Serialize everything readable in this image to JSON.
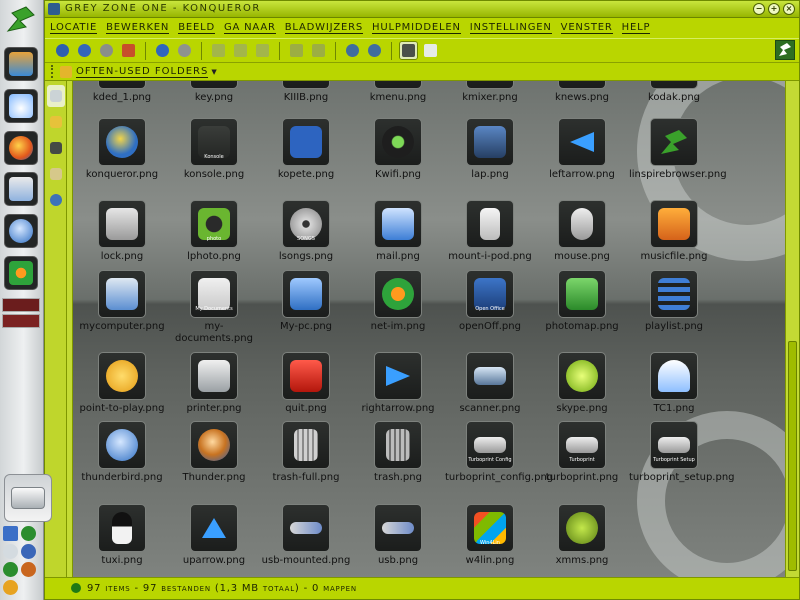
{
  "window": {
    "title": "GREY ZONE ONE - Konqueror"
  },
  "menubar": {
    "items": [
      "Locatie",
      "Bewerken",
      "Beeld",
      "Ga naar",
      "Bladwijzers",
      "Hulpmiddelen",
      "Instellingen",
      "Venster",
      "Help"
    ]
  },
  "bookmarks_toolbar": {
    "folder_label": "Often-used Folders"
  },
  "files": {
    "row0": [
      "kded_1.png",
      "key.png",
      "KIIIB.png",
      "kmenu.png",
      "kmixer.png",
      "knews.png",
      "kodak.png"
    ],
    "row1": [
      "konqueror.png",
      "konsole.png",
      "kopete.png",
      "Kwifi.png",
      "lap.png",
      "leftarrow.png",
      "linspirebrowser.png"
    ],
    "row2": [
      "lock.png",
      "lphoto.png",
      "lsongs.png",
      "mail.png",
      "mount-i-pod.png",
      "mouse.png",
      "musicfile.png"
    ],
    "row3": [
      "mycomputer.png",
      "my-documents.png",
      "My-pc.png",
      "net-im.png",
      "openOff.png",
      "photomap.png",
      "playlist.png"
    ],
    "row4": [
      "point-to-play.png",
      "printer.png",
      "quit.png",
      "rightarrow.png",
      "scanner.png",
      "skype.png",
      "TC1.png"
    ],
    "row5": [
      "thunderbird.png",
      "Thunder.png",
      "trash-full.png",
      "trash.png",
      "turboprint_config.png",
      "turboprint.png",
      "turboprint_setup.png"
    ],
    "row6": [
      "tuxi.png",
      "uparrow.png",
      "usb-mounted.png",
      "usb.png",
      "w4lin.png",
      "xmms.png"
    ]
  },
  "tile_labels": {
    "konsole": "Konsole",
    "lphoto": "photo",
    "lsongs": "SONGS",
    "mydocs": "My Documents",
    "openoff": "Open Office",
    "tp_config": "Turboprint Config",
    "tp": "Turboprint",
    "tp_setup": "Turboprint Setup",
    "w4lin": "Win4Lin"
  },
  "status": {
    "text": "97 items - 97 bestanden (1,3 MB totaal) - 0 mappen"
  },
  "colors": {
    "accent": "#b9d600",
    "titlebar": "#97b500",
    "icon_tile": "#1f2120",
    "view_bg": "#6e736f"
  }
}
